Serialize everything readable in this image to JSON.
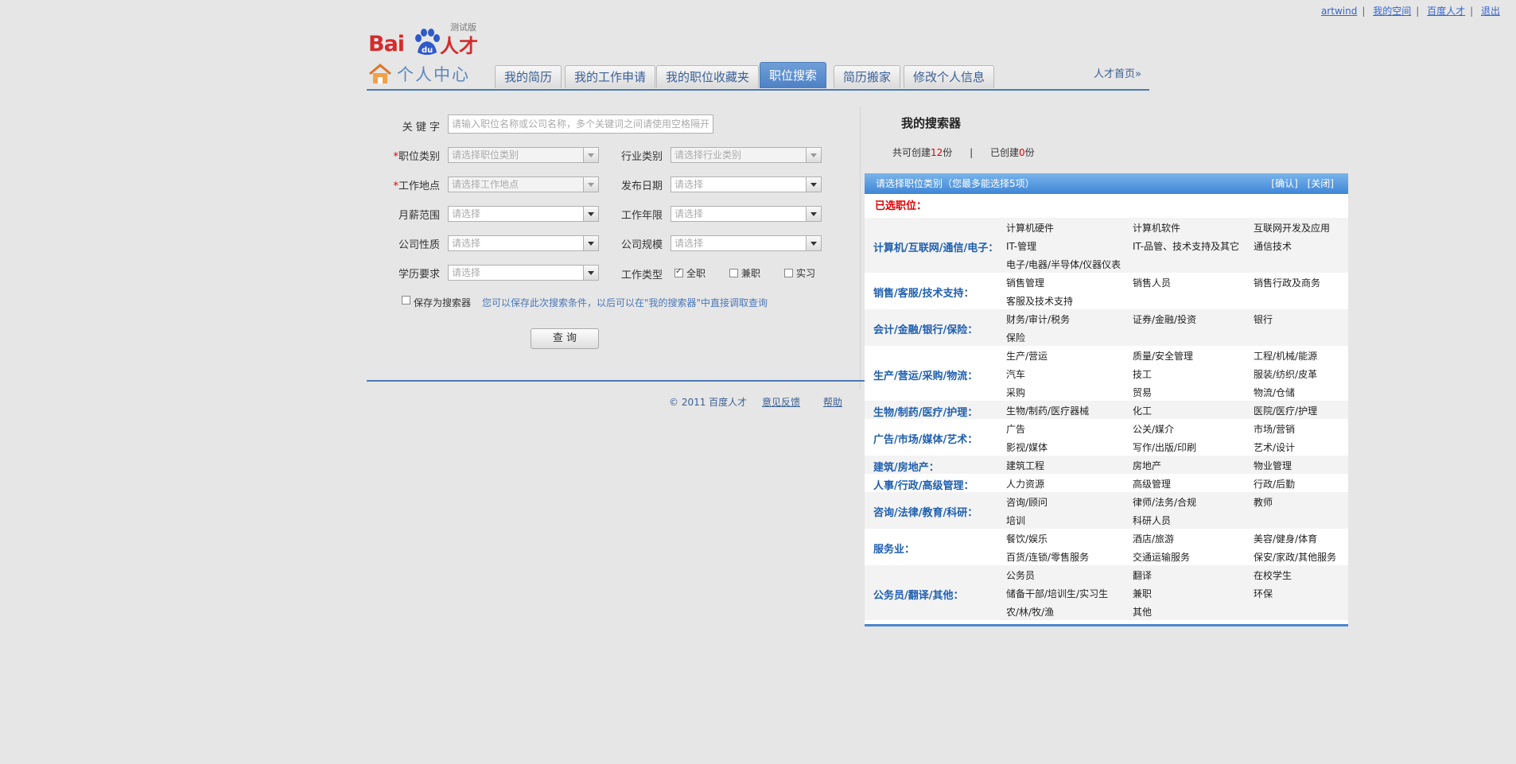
{
  "top_links": [
    "artwind",
    "我的空间",
    "百度人才",
    "退出"
  ],
  "logo": {
    "brand": "Bai",
    "du": "du",
    "product": "人才",
    "badge": "测试版"
  },
  "nav": {
    "title": "个人中心",
    "tabs": [
      "我的简历",
      "我的工作申请",
      "我的职位收藏夹",
      "职位搜索",
      "简历搬家",
      "修改个人信息"
    ],
    "active_tab": "职位搜索",
    "home_link": "人才首页»"
  },
  "form": {
    "keyword_label": "关 键 字",
    "keyword_placeholder": "请输入职位名称或公司名称，多个关键词之间请使用空格隔开",
    "job_category_label": "职位类别",
    "job_category_value": "请选择职位类别",
    "industry_label": "行业类别",
    "industry_value": "请选择行业类别",
    "location_label": "工作地点",
    "location_value": "请选择工作地点",
    "publish_date_label": "发布日期",
    "publish_date_value": "请选择",
    "salary_label": "月薪范围",
    "salary_value": "请选择",
    "years_label": "工作年限",
    "years_value": "请选择",
    "company_type_label": "公司性质",
    "company_type_value": "请选择",
    "company_size_label": "公司规模",
    "company_size_value": "请选择",
    "education_label": "学历要求",
    "education_value": "请选择",
    "job_type_label": "工作类型",
    "job_types": [
      {
        "label": "全职",
        "checked": true
      },
      {
        "label": "兼职",
        "checked": false
      },
      {
        "label": "实习",
        "checked": false
      }
    ],
    "save_label": "保存为搜索器",
    "save_hint": "您可以保存此次搜索条件，以后可以在\"我的搜索器\"中直接调取查询",
    "search_button": "查 询"
  },
  "footer": {
    "copyright": "© 2011 百度人才",
    "feedback": "意见反馈",
    "help": "帮助"
  },
  "searcher": {
    "title": "我的搜索器",
    "can_create_prefix": "共可创建",
    "can_create_num": "12",
    "can_create_suffix": "份",
    "sep": "|",
    "created_prefix": "已创建",
    "created_num": "0",
    "created_suffix": "份"
  },
  "popup": {
    "header": "请选择职位类别（您最多能选择5项）",
    "confirm": "[确认]",
    "close": "[关闭]",
    "selected_label": "已选职位：",
    "groups": [
      {
        "name": "计算机/互联网/通信/电子：",
        "items": [
          "计算机硬件",
          "计算机软件",
          "互联网开发及应用",
          "IT-管理",
          "IT-品管、技术支持及其它",
          "通信技术",
          "电子/电器/半导体/仪器仪表"
        ]
      },
      {
        "name": "销售/客服/技术支持：",
        "items": [
          "销售管理",
          "销售人员",
          "销售行政及商务",
          "客服及技术支持"
        ]
      },
      {
        "name": "会计/金融/银行/保险：",
        "items": [
          "财务/审计/税务",
          "证券/金融/投资",
          "银行",
          "保险"
        ]
      },
      {
        "name": "生产/营运/采购/物流：",
        "items": [
          "生产/营运",
          "质量/安全管理",
          "工程/机械/能源",
          "汽车",
          "技工",
          "服装/纺织/皮革",
          "采购",
          "贸易",
          "物流/仓储"
        ]
      },
      {
        "name": "生物/制药/医疗/护理：",
        "items": [
          "生物/制药/医疗器械",
          "化工",
          "医院/医疗/护理"
        ]
      },
      {
        "name": "广告/市场/媒体/艺术：",
        "items": [
          "广告",
          "公关/媒介",
          "市场/营销",
          "影视/媒体",
          "写作/出版/印刷",
          "艺术/设计"
        ]
      },
      {
        "name": "建筑/房地产：",
        "items": [
          "建筑工程",
          "房地产",
          "物业管理"
        ]
      },
      {
        "name": "人事/行政/高级管理：",
        "items": [
          "人力资源",
          "高级管理",
          "行政/后勤"
        ]
      },
      {
        "name": "咨询/法律/教育/科研：",
        "items": [
          "咨询/顾问",
          "律师/法务/合规",
          "教师",
          "培训",
          "科研人员"
        ]
      },
      {
        "name": "服务业：",
        "items": [
          "餐饮/娱乐",
          "酒店/旅游",
          "美容/健身/体育",
          "百货/连锁/零售服务",
          "交通运输服务",
          "保安/家政/其他服务"
        ]
      },
      {
        "name": "公务员/翻译/其他：",
        "items": [
          "公务员",
          "翻译",
          "在校学生",
          "储备干部/培训生/实习生",
          "兼职",
          "环保",
          "农/林/牧/渔",
          "其他"
        ]
      }
    ]
  }
}
